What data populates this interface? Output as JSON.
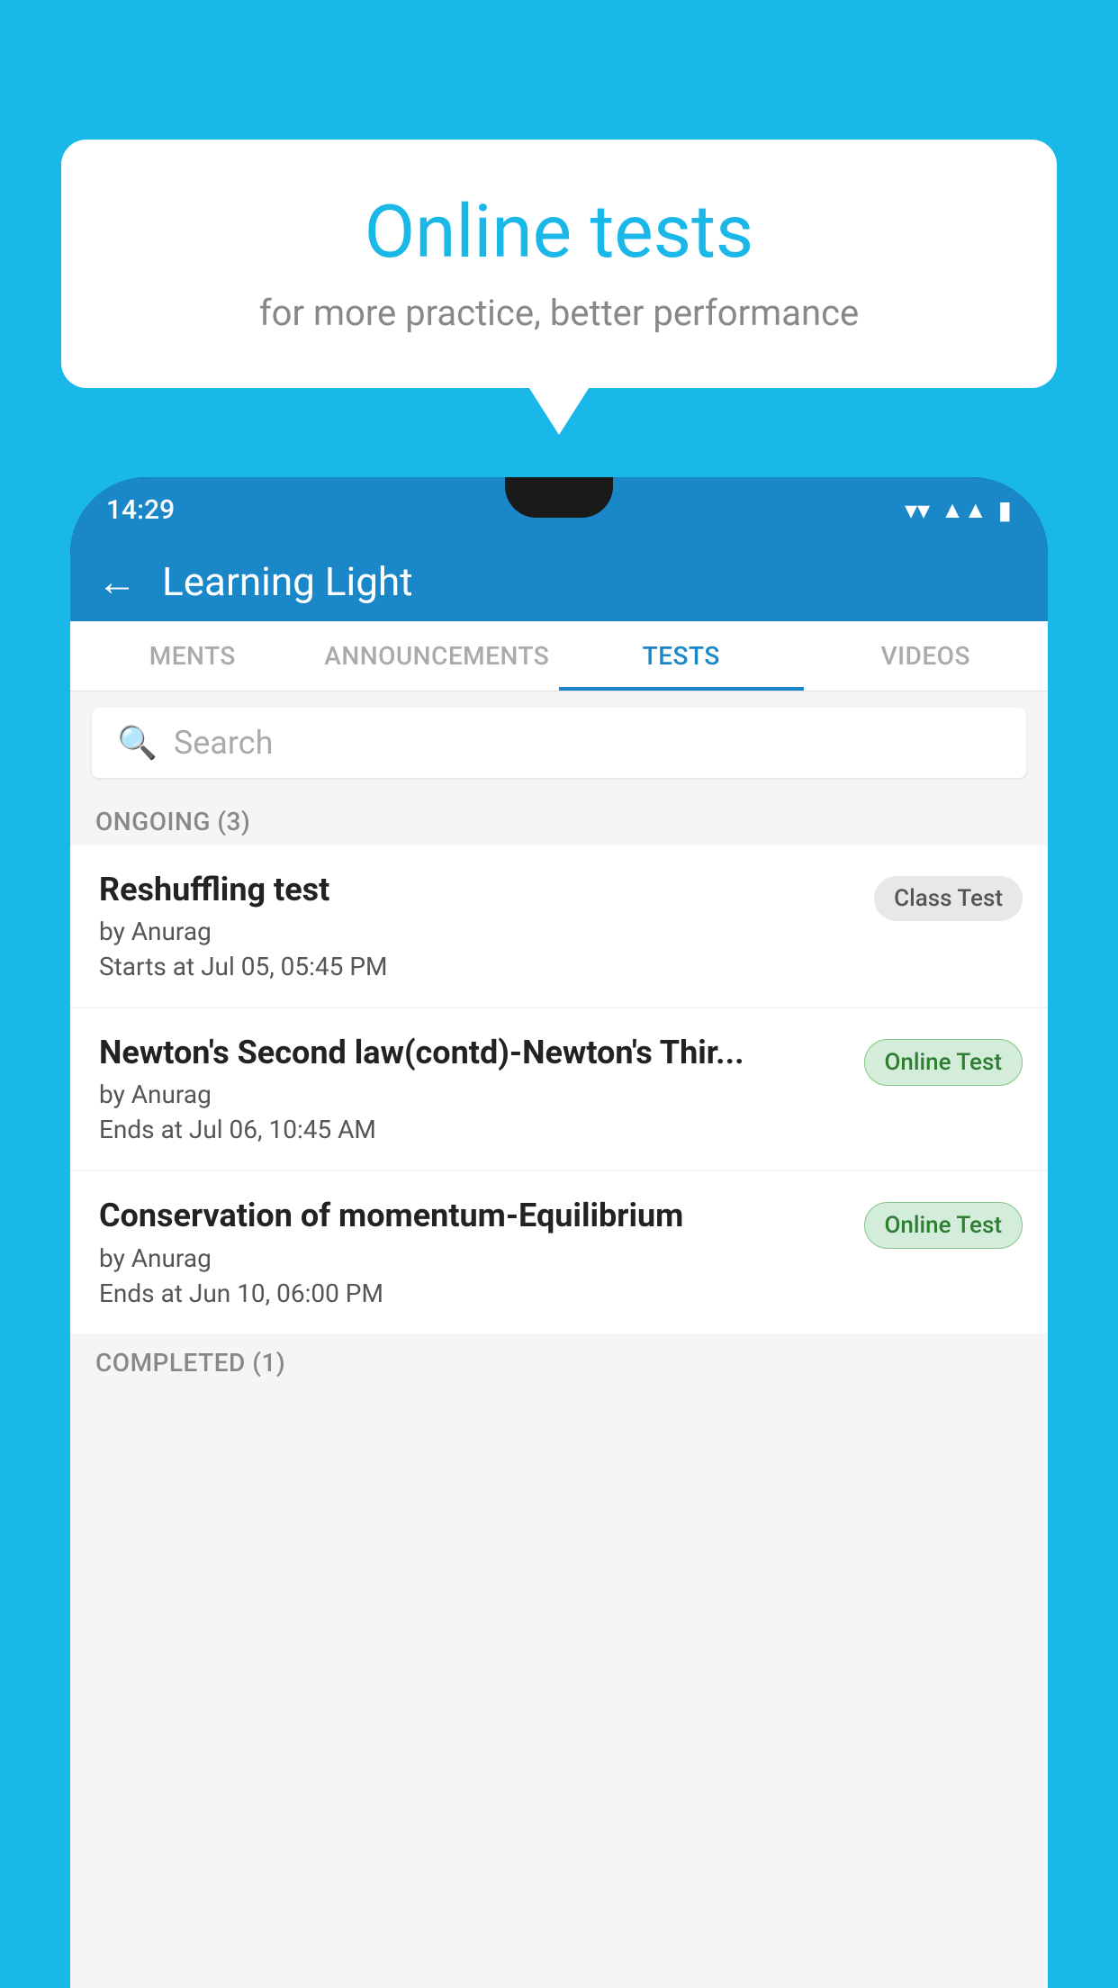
{
  "background_color": "#1ab8e8",
  "speech_bubble": {
    "title": "Online tests",
    "subtitle": "for more practice, better performance"
  },
  "phone": {
    "status_bar": {
      "time": "14:29",
      "wifi_icon": "wifi",
      "signal_icon": "signal",
      "battery_icon": "battery"
    },
    "app_header": {
      "back_icon": "←",
      "title": "Learning Light"
    },
    "tabs": [
      {
        "label": "MENTS",
        "active": false
      },
      {
        "label": "ANNOUNCEMENTS",
        "active": false
      },
      {
        "label": "TESTS",
        "active": true
      },
      {
        "label": "VIDEOS",
        "active": false
      }
    ],
    "search": {
      "placeholder": "Search"
    },
    "sections": [
      {
        "header": "ONGOING (3)",
        "items": [
          {
            "name": "Reshuffling test",
            "author": "by Anurag",
            "date": "Starts at  Jul 05, 05:45 PM",
            "badge": "Class Test",
            "badge_type": "class"
          },
          {
            "name": "Newton's Second law(contd)-Newton's Thir...",
            "author": "by Anurag",
            "date": "Ends at  Jul 06, 10:45 AM",
            "badge": "Online Test",
            "badge_type": "online"
          },
          {
            "name": "Conservation of momentum-Equilibrium",
            "author": "by Anurag",
            "date": "Ends at  Jun 10, 06:00 PM",
            "badge": "Online Test",
            "badge_type": "online"
          }
        ]
      },
      {
        "header": "COMPLETED (1)",
        "items": []
      }
    ]
  }
}
